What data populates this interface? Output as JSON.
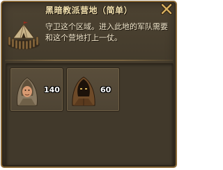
{
  "window": {
    "title": "黑暗教派营地（简单）",
    "description": "守卫这个区域。进入此地的军队需要和这个营地打上一仗。"
  },
  "icons": {
    "close": "close-icon",
    "camp": "camp-icon"
  },
  "units": [
    {
      "icon": "hooded-warrior-icon",
      "count": "140"
    },
    {
      "icon": "dark-cultist-icon",
      "count": "60"
    }
  ],
  "colors": {
    "title": "#f4e2b0",
    "text": "#f1e6cc",
    "panel": "#4d4332",
    "border": "#8a6b3a"
  }
}
